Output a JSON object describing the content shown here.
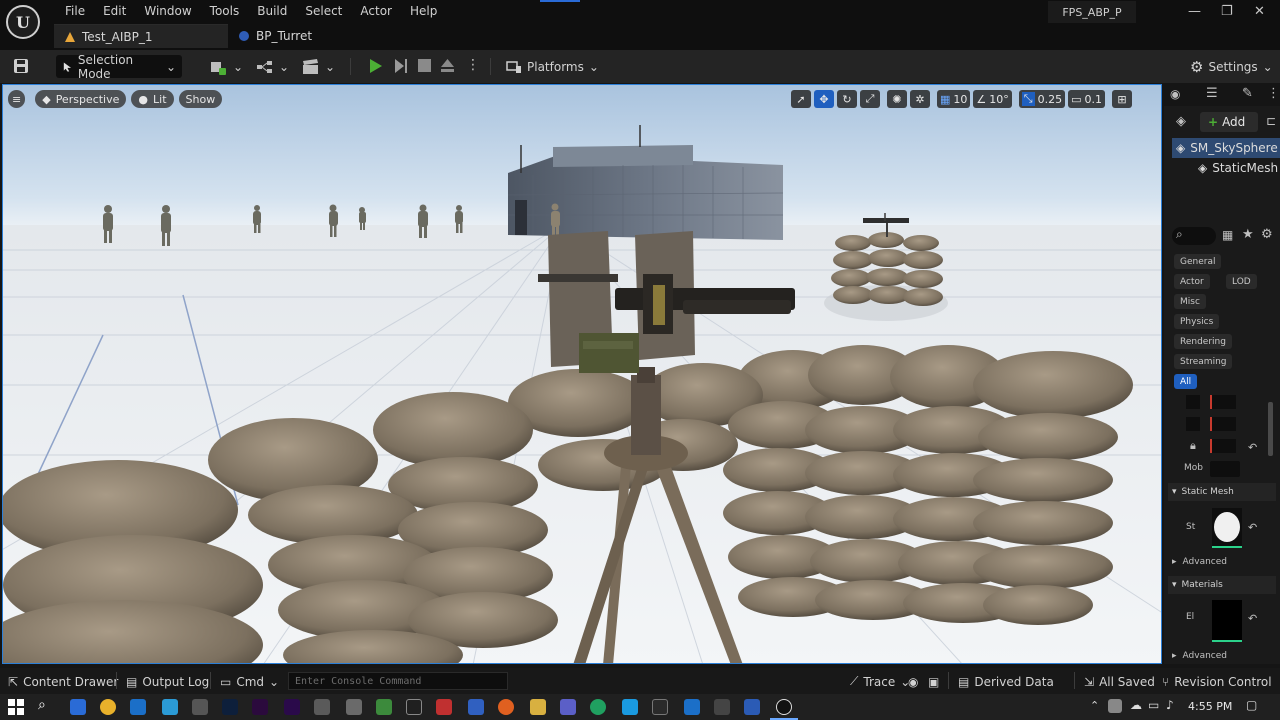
{
  "menu": [
    "File",
    "Edit",
    "Window",
    "Tools",
    "Build",
    "Select",
    "Actor",
    "Help"
  ],
  "tabs": [
    {
      "label": "Test_AIBP_1",
      "icon": "level-icon"
    },
    {
      "label": "BP_Turret",
      "icon": "blueprint-icon"
    }
  ],
  "project_name": "FPS_ABP_P",
  "toolbar": {
    "selection_mode": "Selection Mode",
    "platforms": "Platforms",
    "settings": "Settings"
  },
  "viewport": {
    "perspective": "Perspective",
    "lit": "Lit",
    "show": "Show",
    "grid_snap": "10",
    "rotation_snap": "10°",
    "scale_snap": "0.25",
    "camera_speed": "0.1"
  },
  "details": {
    "add_label": "Add",
    "outliner": [
      "SM_SkySphere",
      "StaticMesh"
    ],
    "filters": [
      "General",
      "Actor",
      "LOD",
      "Misc",
      "Physics",
      "Rendering",
      "Streaming",
      "All"
    ],
    "mobility_label": "Mob",
    "static_mesh_section": "Static Mesh",
    "static_mesh_label": "St",
    "advanced_label_1": "Advanced",
    "materials_section": "Materials",
    "element_label": "El",
    "advanced_label_2": "Advanced"
  },
  "statusbar": {
    "content_drawer": "Content Drawer",
    "output_log": "Output Log",
    "cmd": "Cmd",
    "console_placeholder": "Enter Console Command",
    "trace": "Trace",
    "derived_data": "Derived Data",
    "all_saved": "All Saved",
    "revision_control": "Revision Control"
  },
  "taskbar": {
    "time": "4:55 PM"
  },
  "colors": {
    "accent": "#2b7fd8",
    "play_green": "#4caf35",
    "selected_row": "#2e4a72"
  }
}
